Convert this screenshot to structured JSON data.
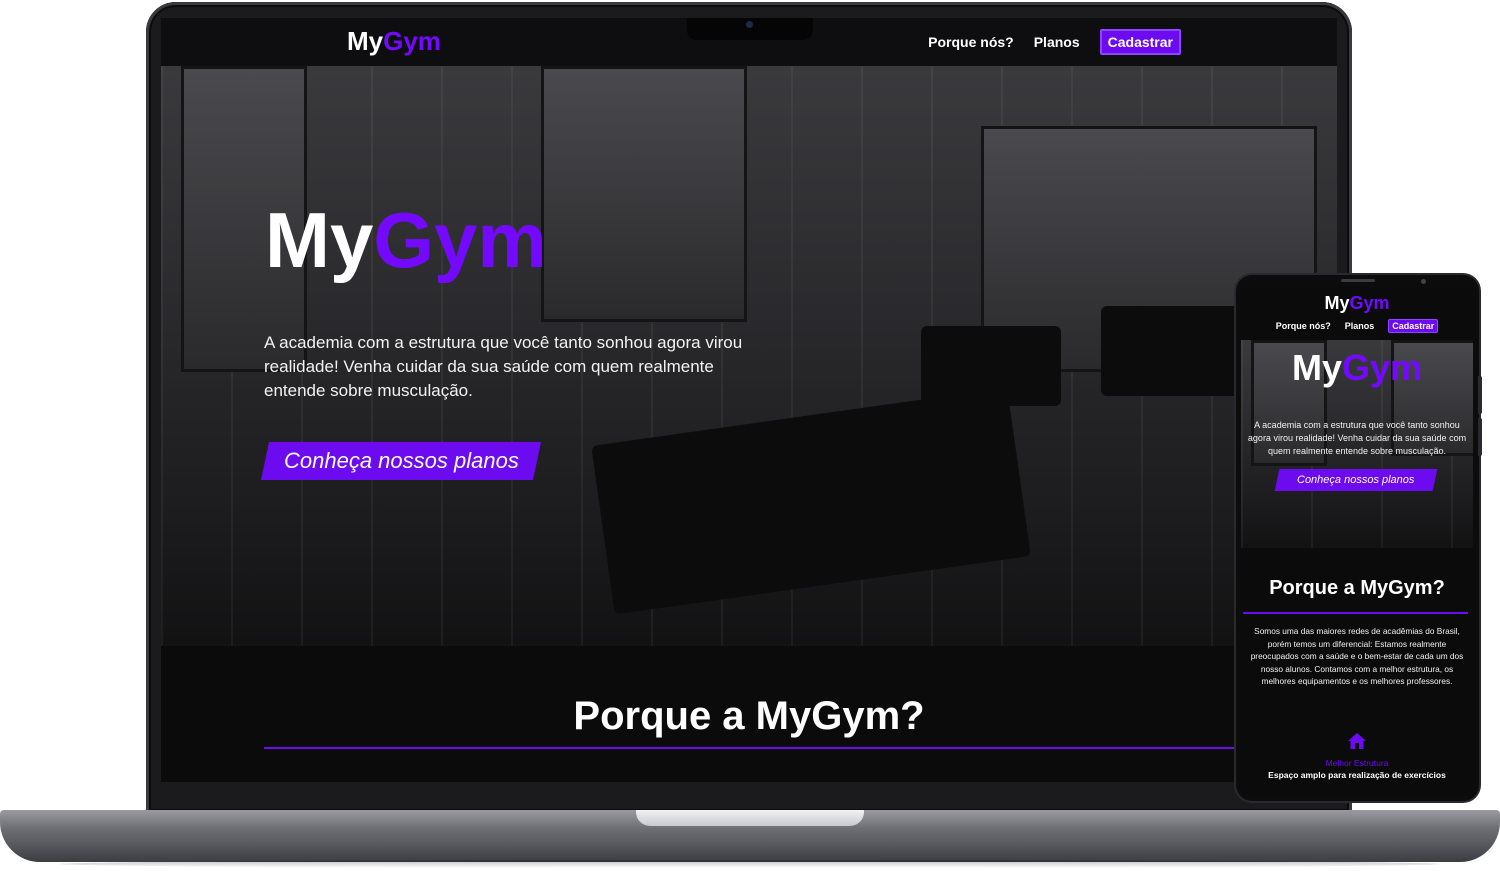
{
  "brand": {
    "part1": "My",
    "part2": "Gym",
    "accent_color": "#6c0af0"
  },
  "nav": {
    "links": [
      "Porque nós?",
      "Planos"
    ],
    "cta": "Cadastrar"
  },
  "hero": {
    "title_part1": "My",
    "title_part2": "Gym",
    "text": "A academia com a estrutura que você tanto sonhou agora virou realidade! Venha cuidar da sua saúde com quem realmente entende sobre musculação.",
    "cta": "Conheça nossos planos"
  },
  "why": {
    "title": "Porque a MyGym?",
    "text": "Somos uma das maiores redes de acadêmias do Brasil, porém temos um diferencial: Estamos realmente preocupados com a saúde e o bem-estar de cada um dos nosso alunos. Contamos com a melhor estrutura, os melhores equipamentos e os melhores professores."
  },
  "feature": {
    "icon": "house-icon",
    "title": "Melhor Estrutura",
    "text": "Espaço amplo para realização de exercícios"
  }
}
